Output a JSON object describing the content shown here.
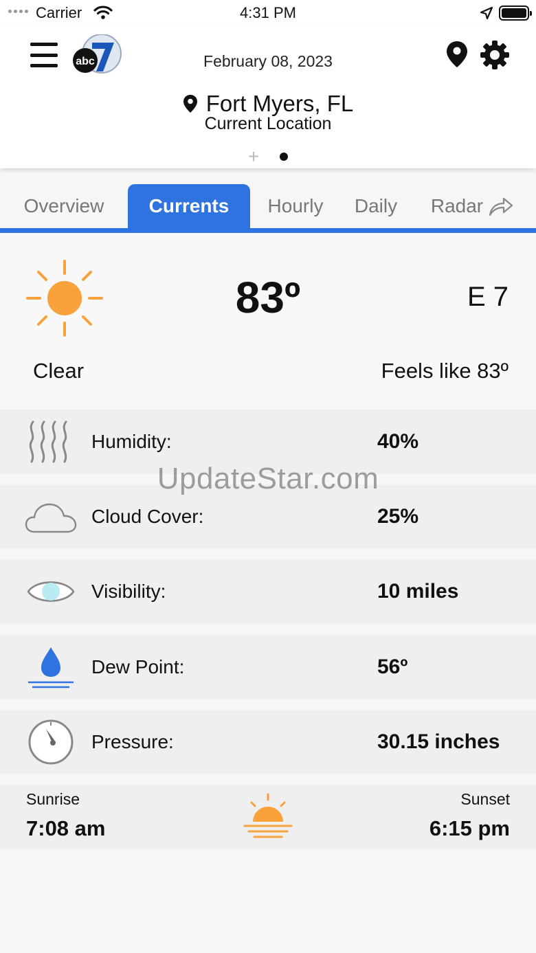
{
  "status_bar": {
    "carrier": "Carrier",
    "time": "4:31 PM"
  },
  "header": {
    "date": "February 08, 2023",
    "location_name": "Fort Myers, FL",
    "location_sub": "Current Location",
    "logo_text": "abc",
    "logo_number": "7"
  },
  "tabs": [
    {
      "label": "Overview",
      "active": false
    },
    {
      "label": "Currents",
      "active": true
    },
    {
      "label": "Hourly",
      "active": false
    },
    {
      "label": "Daily",
      "active": false
    },
    {
      "label": "Radar",
      "active": false
    }
  ],
  "current": {
    "temperature": "83º",
    "wind": "E 7",
    "condition": "Clear",
    "feels_like": "Feels like 83º"
  },
  "details": [
    {
      "icon": "humidity-icon",
      "label": "Humidity:",
      "value": "40%"
    },
    {
      "icon": "cloud-icon",
      "label": "Cloud Cover:",
      "value": "25%"
    },
    {
      "icon": "eye-icon",
      "label": "Visibility:",
      "value": "10 miles"
    },
    {
      "icon": "water-drop-icon",
      "label": "Dew Point:",
      "value": "56º"
    },
    {
      "icon": "gauge-icon",
      "label": "Pressure:",
      "value": "30.15 inches"
    }
  ],
  "sun": {
    "sunrise_label": "Sunrise",
    "sunrise_time": "7:08 am",
    "sunset_label": "Sunset",
    "sunset_time": "6:15 pm"
  },
  "watermark": "UpdateStar.com",
  "colors": {
    "accent": "#2f73e0",
    "sun": "#f9a23c",
    "drop": "#2f73e0"
  }
}
